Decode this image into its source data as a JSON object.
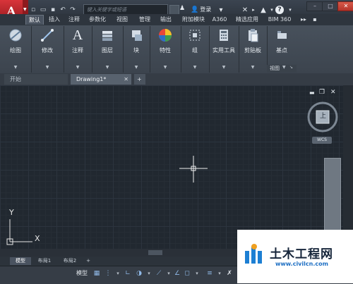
{
  "title_bar": {
    "app_letter": "A",
    "search_placeholder": "键入关键字或短语",
    "user_label": "登录",
    "help_label": "?",
    "win_min": "–",
    "win_max": "□",
    "win_close": "✕"
  },
  "ribbon_tabs": [
    "默认",
    "插入",
    "注释",
    "参数化",
    "视图",
    "管理",
    "输出",
    "附加模块",
    "A360",
    "精选应用",
    "BIM 360"
  ],
  "ribbon_tab_active": "默认",
  "ribbon_panels": [
    {
      "label": "绘图"
    },
    {
      "label": "修改"
    },
    {
      "label": "注释"
    },
    {
      "label": "图层"
    },
    {
      "label": "块"
    },
    {
      "label": "特性"
    },
    {
      "label": "组"
    },
    {
      "label": "实用工具"
    },
    {
      "label": "剪贴板"
    },
    {
      "label": "基点"
    }
  ],
  "view_footer": "视图",
  "doc_tabs": {
    "start": "开始",
    "drawing": "Drawing1*",
    "add": "+"
  },
  "viewcube": {
    "compass_label": "WCS",
    "face_label": "上"
  },
  "ucs": {
    "x_label": "X",
    "y_label": "Y"
  },
  "layout_tabs": [
    "模型",
    "布局1",
    "布局2"
  ],
  "layout_add": "+",
  "status": {
    "model_label": "模型"
  },
  "watermark": {
    "name": "土木工程网",
    "url": "www.civilcn.com"
  }
}
